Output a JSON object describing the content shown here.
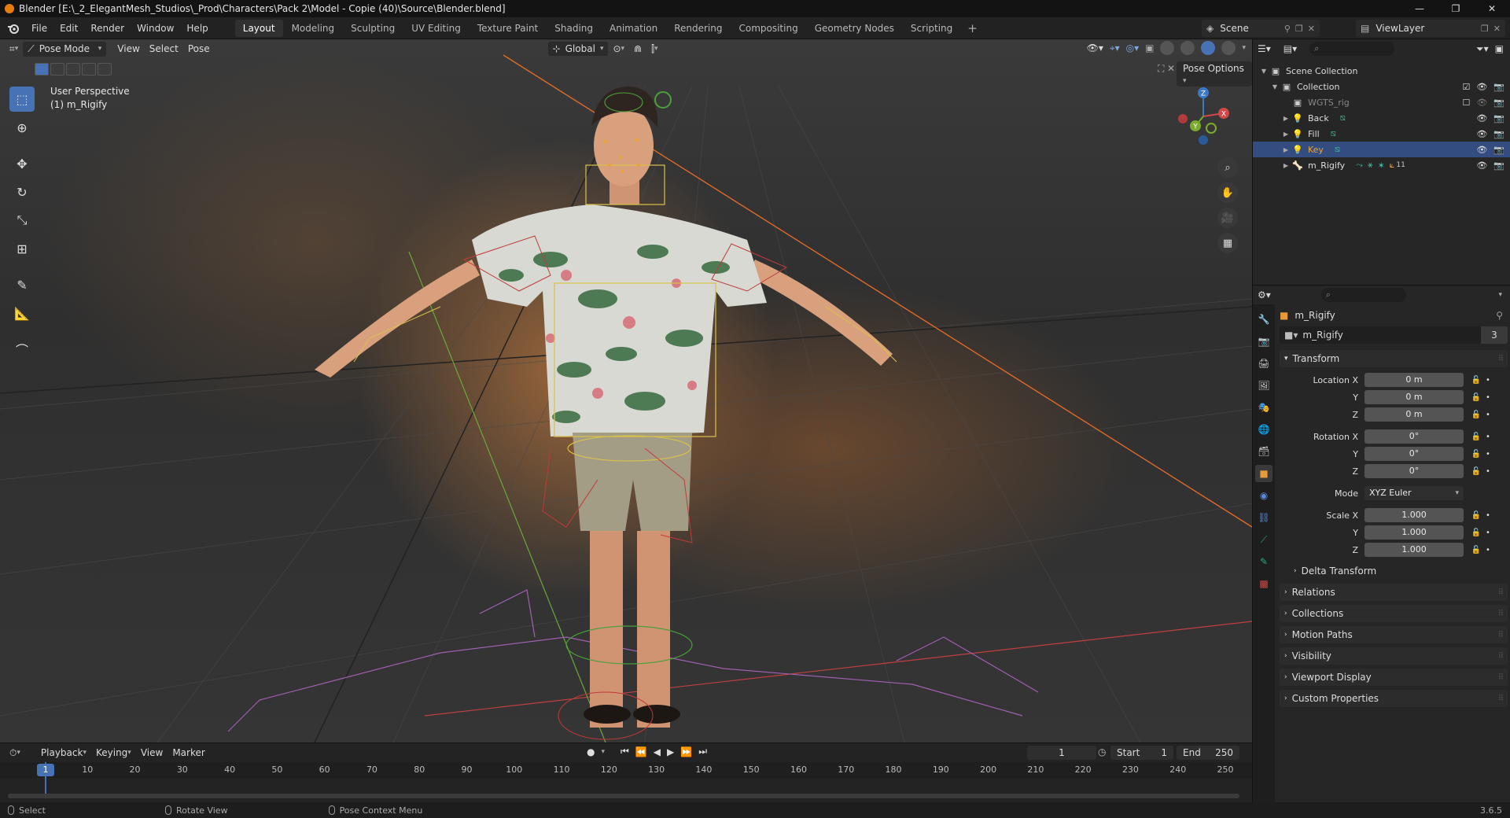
{
  "window": {
    "title": "Blender [E:\\_2_ElegantMesh_Studios\\_Prod\\Characters\\Pack 2\\Model - Copie (40)\\Source\\Blender.blend]",
    "controls": [
      "—",
      "❐",
      "✕"
    ]
  },
  "menu": [
    "File",
    "Edit",
    "Render",
    "Window",
    "Help"
  ],
  "workspaces": [
    "Layout",
    "Modeling",
    "Sculpting",
    "UV Editing",
    "Texture Paint",
    "Shading",
    "Animation",
    "Rendering",
    "Compositing",
    "Geometry Nodes",
    "Scripting"
  ],
  "active_workspace": "Layout",
  "add_workspace": "+",
  "scene": {
    "label": "Scene"
  },
  "view_layer": {
    "label": "ViewLayer"
  },
  "viewport": {
    "mode": "Pose Mode",
    "menus": [
      "View",
      "Select",
      "Pose"
    ],
    "orientation": "Global",
    "perspective_label": "User Perspective",
    "active_object_label": "(1) m_Rigify",
    "pose_options": "Pose Options",
    "gizmo_axes": {
      "x": "X",
      "y": "Y",
      "z": "Z"
    }
  },
  "timeline": {
    "menus": [
      "Playback",
      "Keying",
      "View",
      "Marker"
    ],
    "current_frame": "1",
    "start_label": "Start",
    "start": "1",
    "end_label": "End",
    "end": "250",
    "ruler": [
      "10",
      "20",
      "30",
      "40",
      "50",
      "60",
      "70",
      "80",
      "90",
      "100",
      "110",
      "120",
      "130",
      "140",
      "150",
      "160",
      "170",
      "180",
      "190",
      "200",
      "210",
      "220",
      "230",
      "240",
      "250"
    ],
    "playhead_label": "1"
  },
  "status": {
    "select": "Select",
    "rotate": "Rotate View",
    "context": "Pose Context Menu",
    "version": "3.6.5"
  },
  "outliner": {
    "rows": [
      {
        "label": "Scene Collection",
        "indent": 0,
        "type": "scene"
      },
      {
        "label": "Collection",
        "indent": 1,
        "type": "collection"
      },
      {
        "label": "WGTS_rig",
        "indent": 2,
        "type": "collection-dim"
      },
      {
        "label": "Back",
        "indent": 2,
        "type": "light"
      },
      {
        "label": "Fill",
        "indent": 2,
        "type": "light"
      },
      {
        "label": "Key",
        "indent": 2,
        "type": "light",
        "selected": true
      },
      {
        "label": "m_Rigify",
        "indent": 2,
        "type": "armature"
      }
    ],
    "extra_count": "11"
  },
  "properties": {
    "object_name": "m_Rigify",
    "data_name": "m_Rigify",
    "users": "3",
    "transform_label": "Transform",
    "location": {
      "label_x": "Location X",
      "label_y": "Y",
      "label_z": "Z",
      "x": "0 m",
      "y": "0 m",
      "z": "0 m"
    },
    "rotation": {
      "label_x": "Rotation X",
      "label_y": "Y",
      "label_z": "Z",
      "x": "0°",
      "y": "0°",
      "z": "0°"
    },
    "mode": {
      "label": "Mode",
      "value": "XYZ Euler"
    },
    "scale": {
      "label_x": "Scale X",
      "label_y": "Y",
      "label_z": "Z",
      "x": "1.000",
      "y": "1.000",
      "z": "1.000"
    },
    "delta_transform": "Delta Transform",
    "panels": [
      "Relations",
      "Collections",
      "Motion Paths",
      "Visibility",
      "Viewport Display",
      "Custom Properties"
    ]
  },
  "colors": {
    "accent": "#4772b3",
    "selected_row": "#334d80",
    "light_orange": "#e8a33c",
    "x_axis": "#d04848",
    "y_axis": "#7aab2e",
    "z_axis": "#3b78c9"
  }
}
